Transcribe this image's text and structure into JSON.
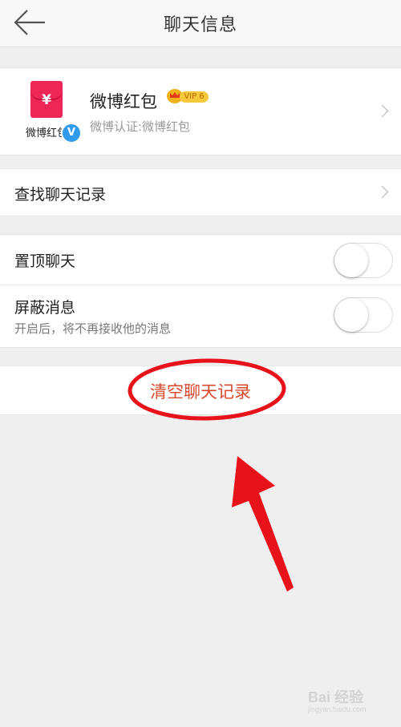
{
  "header": {
    "title": "聊天信息",
    "back_icon": "arrow-left-icon"
  },
  "profile": {
    "name": "微博红包",
    "avatar_text": "微博红包",
    "avatar_symbol": "¥",
    "vip_label": "VIP 6",
    "verified": "V",
    "certification": "微博认证:微博红包",
    "avatar_color": "#ee2557"
  },
  "search": {
    "label": "查找聊天记录"
  },
  "settings": {
    "pin": {
      "label": "置顶聊天",
      "enabled": false
    },
    "mute": {
      "label": "屏蔽消息",
      "description": "开启后，将不再接收他的消息",
      "enabled": false
    }
  },
  "clear": {
    "label": "清空聊天记录",
    "color": "#d94a2d"
  },
  "annotation": {
    "color": "#e8121b"
  },
  "watermark": {
    "text": "Bai 经验",
    "sub": "jingyan.baidu.com"
  }
}
